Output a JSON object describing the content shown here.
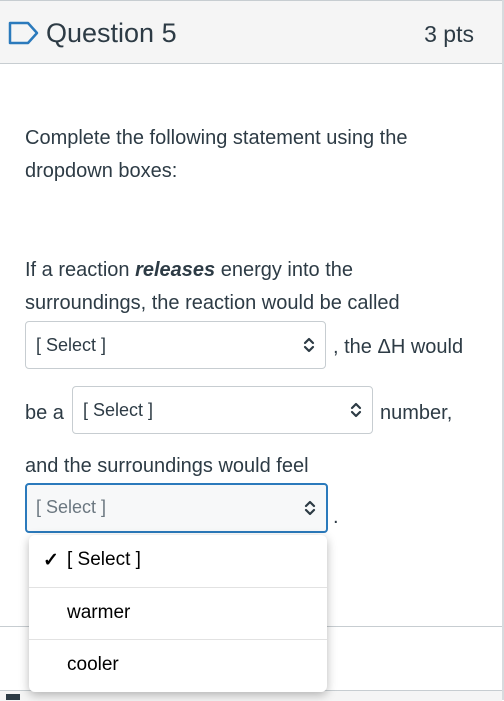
{
  "question": {
    "title": "Question 5",
    "points": "3 pts"
  },
  "instructions": {
    "line1": "Complete the following statement using the",
    "line2": "dropdown boxes:"
  },
  "statement": {
    "p1_start": "If a reaction ",
    "p1_bold": "releases",
    "p1_end": " energy into the",
    "p2": "surroundings, the reaction would be called",
    "after_select1": ", the ΔH would",
    "before_select2": "be a",
    "after_select2": "number,",
    "p5": "and the surroundings would feel",
    "after_select3": "."
  },
  "selects": {
    "select1": "[ Select ]",
    "select2": "[ Select ]",
    "select3": "[ Select ]"
  },
  "dropdown_menu": {
    "options": [
      "[ Select ]",
      "warmer",
      "cooler"
    ],
    "checked": "✓"
  }
}
